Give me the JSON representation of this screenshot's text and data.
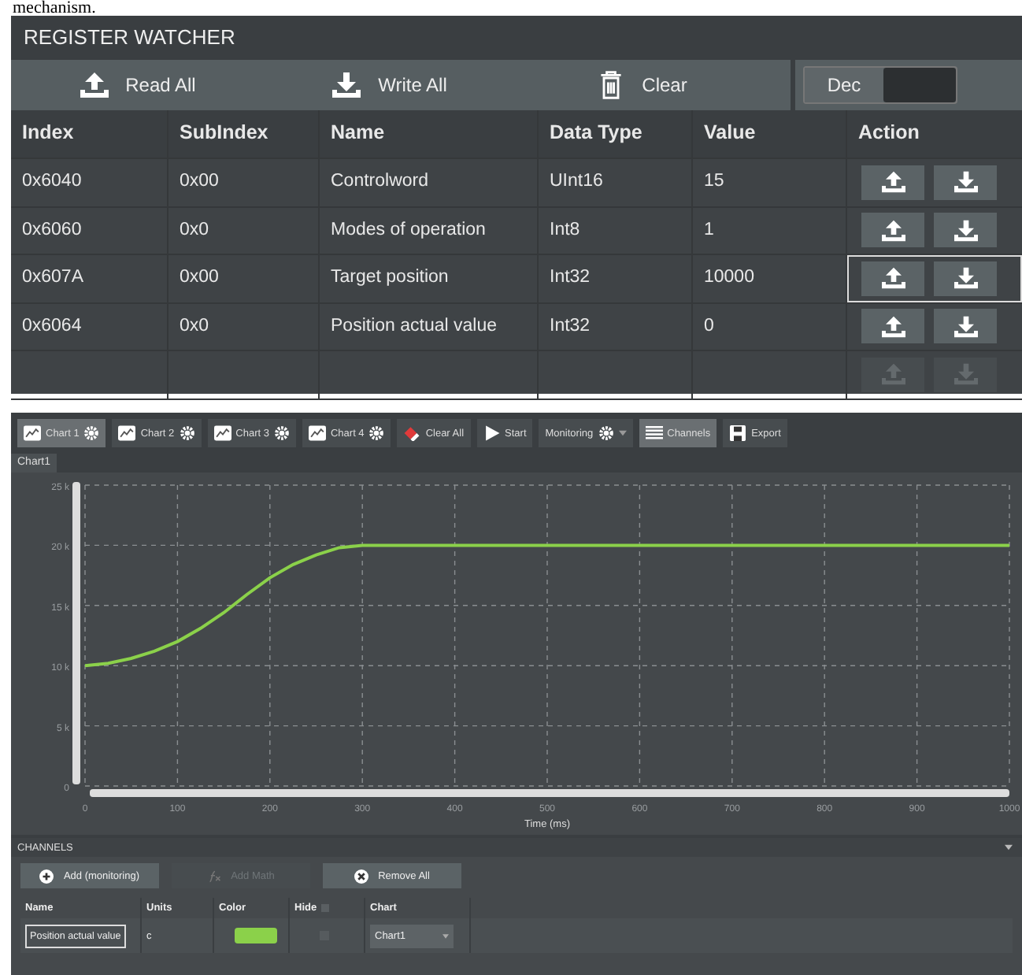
{
  "caption": "mechanism.",
  "register_watcher": {
    "title": "REGISTER WATCHER",
    "toolbar": [
      {
        "kind": "upload",
        "label": "Read All"
      },
      {
        "kind": "download",
        "label": "Write All"
      },
      {
        "kind": "trash",
        "label": "Clear"
      }
    ],
    "format_label": "Dec",
    "table": {
      "columns": [
        "Index",
        "SubIndex",
        "Name",
        "Data Type",
        "Value",
        "Action"
      ],
      "rows": [
        {
          "index": "0x6040",
          "subindex": "0x00",
          "name": "Controlword",
          "data_type": "UInt16",
          "value": "15",
          "selected": false,
          "disabled": false
        },
        {
          "index": "0x6060",
          "subindex": "0x0",
          "name": "Modes of operation",
          "data_type": "Int8",
          "value": "1",
          "selected": false,
          "disabled": false
        },
        {
          "index": "0x607A",
          "subindex": "0x00",
          "name": "Target position",
          "data_type": "Int32",
          "value": "10000",
          "selected": true,
          "disabled": false
        },
        {
          "index": "0x6064",
          "subindex": "0x0",
          "name": "Position actual value",
          "data_type": "Int32",
          "value": "0",
          "selected": false,
          "disabled": false
        },
        {
          "selected": false,
          "disabled": true
        }
      ]
    }
  },
  "chart_panel": {
    "toolbar": [
      {
        "kind": "chart",
        "label": "Chart 1",
        "selected": true
      },
      {
        "kind": "chart",
        "label": "Chart 2",
        "selected": false
      },
      {
        "kind": "chart",
        "label": "Chart 3",
        "selected": false
      },
      {
        "kind": "chart",
        "label": "Chart 4",
        "selected": false
      },
      {
        "kind": "clear",
        "label": "Clear All",
        "selected": false
      },
      {
        "kind": "start",
        "label": "Start",
        "selected": false
      },
      {
        "kind": "monitoring",
        "label": "Monitoring",
        "selected": false
      },
      {
        "kind": "channels",
        "label": "Channels",
        "selected": true
      },
      {
        "kind": "export",
        "label": "Export",
        "selected": false
      }
    ],
    "tab": "Chart1",
    "chart_data": {
      "type": "line",
      "xlabel": "Time (ms)",
      "x": [
        0,
        25,
        50,
        75,
        100,
        125,
        150,
        175,
        200,
        225,
        250,
        275,
        300,
        400,
        500,
        600,
        700,
        800,
        900,
        1000
      ],
      "grid": true,
      "series": [
        {
          "color": "#8bd14a",
          "values": [
            10000,
            10200,
            10600,
            11200,
            12000,
            13100,
            14400,
            15900,
            17300,
            18400,
            19200,
            19800,
            20000,
            20000,
            20000,
            20000,
            20000,
            20000,
            20000,
            20000
          ]
        }
      ],
      "xlim": [
        0,
        1000
      ],
      "ylim": [
        0,
        25000
      ],
      "xticks": [
        0,
        100,
        200,
        300,
        400,
        500,
        600,
        700,
        800,
        900,
        1000
      ],
      "yticks": [
        {
          "value": 0,
          "label": "0"
        },
        {
          "value": 5000,
          "label": "5 k"
        },
        {
          "value": 10000,
          "label": "10 k"
        },
        {
          "value": 15000,
          "label": "15 k"
        },
        {
          "value": 20000,
          "label": "20 k"
        },
        {
          "value": 25000,
          "label": "25 k"
        }
      ]
    }
  },
  "channels": {
    "title": "CHANNELS",
    "buttons": [
      {
        "kind": "add",
        "label": "Add (monitoring)",
        "disabled": false
      },
      {
        "kind": "math",
        "label": "Add Math",
        "disabled": true
      },
      {
        "kind": "remove",
        "label": "Remove All",
        "disabled": false
      }
    ],
    "columns": [
      "Name",
      "Units",
      "Color",
      "Hide",
      "Chart"
    ],
    "hide_all": false,
    "rows": [
      {
        "name": "Position actual value",
        "units": "c",
        "color": "#8bd14a",
        "hide": false,
        "chart": "Chart1"
      }
    ]
  }
}
